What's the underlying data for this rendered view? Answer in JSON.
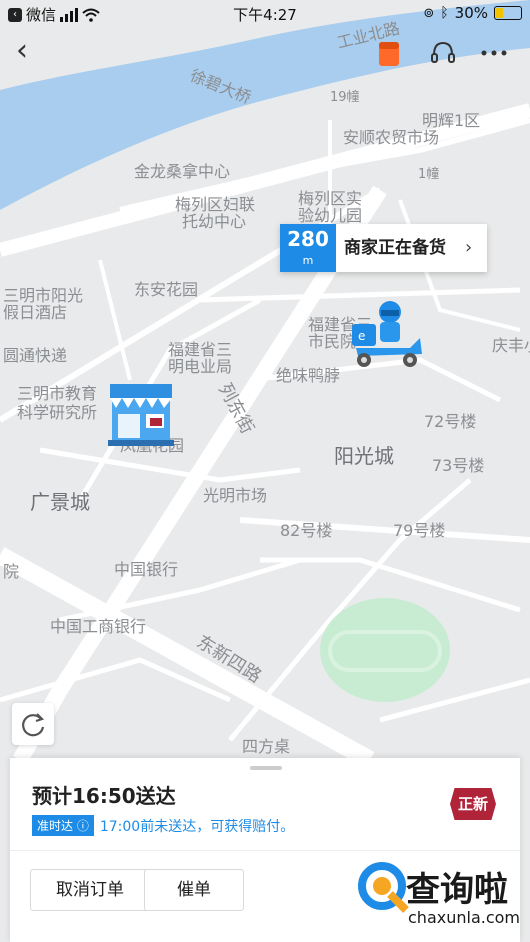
{
  "status_bar": {
    "carrier": "微信",
    "time": "下午4:27",
    "battery": "30%"
  },
  "map": {
    "labels": [
      "工业北路",
      "徐碧大桥",
      "19幢",
      "明辉1区",
      "安顺农贸市场",
      "金龙桑拿中心",
      "梅列区妇联",
      "托幼中心",
      "梅列区实",
      "验幼儿园",
      "1幢",
      "东安花园",
      "三明市阳光",
      "假日酒店",
      "福建省三",
      "明电业局",
      "福建省三",
      "市民院",
      "庆丰小",
      "圆通快递",
      "绝味鸭脖",
      "三明市教育",
      "科学研究所",
      "72号楼",
      "列东街",
      "阳光城",
      "73号楼",
      "凤凰花园",
      "广景城",
      "光明市场",
      "82号楼",
      "79号楼",
      "院",
      "中国银行",
      "中国工商银行",
      "东新四路",
      "四方桌"
    ],
    "colors": {
      "water": "#a8cdee",
      "road": "#ffffff",
      "land": "#e9eaeb",
      "park": "#c8ecd2"
    }
  },
  "delivery_bubble": {
    "distance": "280",
    "unit": "m",
    "status": "商家正在备货"
  },
  "order": {
    "eta": "预计16:50送达",
    "ontime_badge": "准时达",
    "ontime_text": "17:00前未送达，可获得赔付。",
    "shop_logo_text": "正新",
    "cancel_label": "取消订单",
    "urge_label": "催单"
  },
  "watermark": {
    "title": "查询啦",
    "domain": "chaxunla.com"
  },
  "colors": {
    "accent": "#1e8ce6",
    "brand": "#b0243a"
  }
}
